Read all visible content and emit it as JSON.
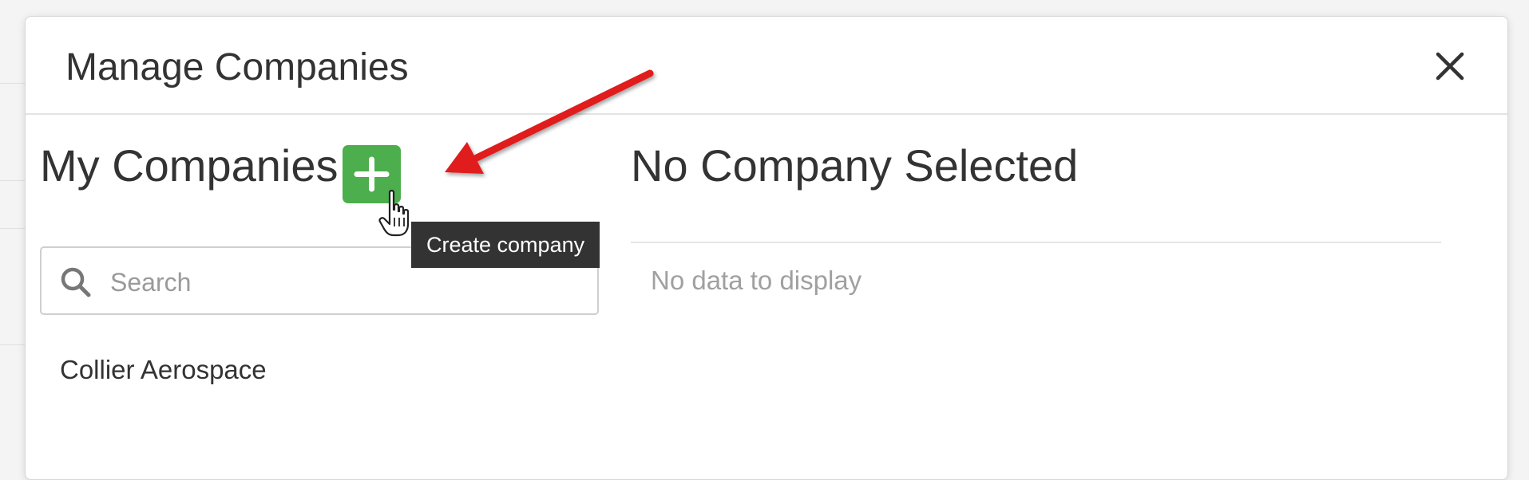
{
  "modal": {
    "title": "Manage Companies",
    "close_icon": "close-icon"
  },
  "left_panel": {
    "heading": "My Companies",
    "add_button_icon": "plus-icon",
    "tooltip": "Create company",
    "search": {
      "placeholder": "Search",
      "value": ""
    },
    "companies": [
      "Collier Aerospace"
    ]
  },
  "right_panel": {
    "heading": "No Company Selected",
    "empty_text": "No data to display"
  },
  "colors": {
    "add_button": "#4cae4c",
    "tooltip_bg": "#333333",
    "annotation_arrow": "#e01b1b"
  }
}
